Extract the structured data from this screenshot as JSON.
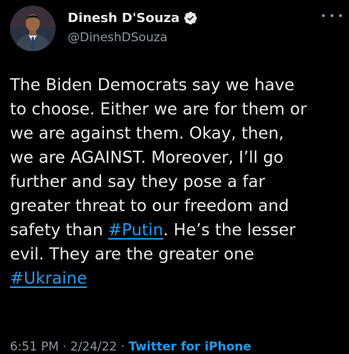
{
  "author": {
    "display_name": "Dinesh D'Souza",
    "handle": "@DineshDSouza",
    "verified_icon": "verified-badge-icon"
  },
  "menu": {
    "more_icon": "more-horizontal-icon"
  },
  "tweet": {
    "line1": "The Biden Democrats say we have",
    "line2": "to choose. Either we are for them or",
    "line3": "we are against  them. Okay, then,",
    "line4": "we are AGAINST. Moreover, I’ll go",
    "line5": "further and say they pose a far",
    "line6": "greater threat to our freedom and",
    "line7_before": "safety than ",
    "hashtag_putin": "#Putin",
    "line7_after": ". He’s the lesser",
    "line8": "evil. They are the greater one",
    "hashtag_ukraine": "#Ukraine"
  },
  "meta": {
    "time": "6:51 PM",
    "sep1": " · ",
    "date": "2/24/22",
    "sep2": " · ",
    "source": "Twitter for iPhone"
  },
  "colors": {
    "background": "#000000",
    "text": "#e7e9ea",
    "secondary": "#8b98a5",
    "accent": "#1d9bf0"
  }
}
